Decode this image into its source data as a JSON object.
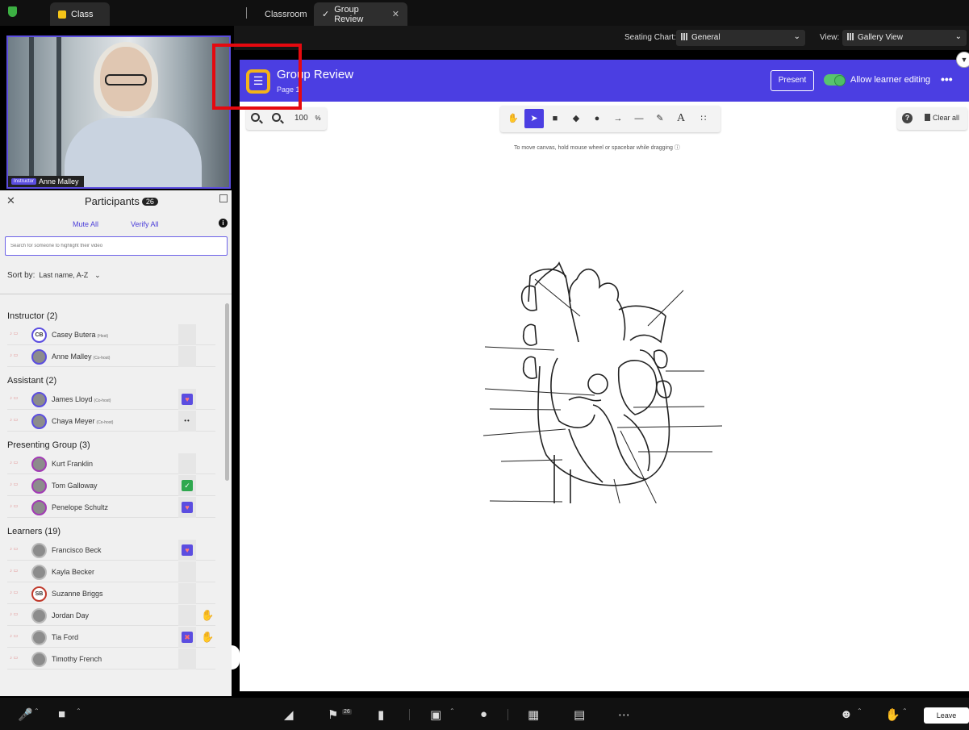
{
  "tabs": {
    "class": "Class",
    "classroom": "Classroom",
    "group_review": "Group Review"
  },
  "seating": {
    "chart_label": "Seating Chart:",
    "chart_value": "General",
    "view_label": "View:",
    "view_value": "Gallery View"
  },
  "video": {
    "role": "Instructor",
    "name": "Anne Malley"
  },
  "participants": {
    "title": "Participants",
    "count": "26",
    "mute_all": "Mute All",
    "verify_all": "Verify All",
    "search_placeholder": "Search for someone to highlight their video",
    "sort_label": "Sort by:",
    "sort_value": "Last name, A-Z",
    "groups": [
      {
        "label": "Instructor (2)",
        "members": [
          {
            "name": "Casey Butera",
            "tag": "(Host)",
            "initials": "CB",
            "status": ""
          },
          {
            "name": "Anne Malley",
            "tag": "(Co-host)",
            "initials": "",
            "status": ""
          }
        ]
      },
      {
        "label": "Assistant (2)",
        "members": [
          {
            "name": "James Lloyd",
            "tag": "(Co-host)",
            "initials": "",
            "status": "heart"
          },
          {
            "name": "Chaya Meyer",
            "tag": "(Co-host)",
            "initials": "",
            "status": "dots"
          }
        ]
      },
      {
        "label": "Presenting Group  (3)",
        "members": [
          {
            "name": "Kurt Franklin",
            "tag": "",
            "initials": "",
            "status": ""
          },
          {
            "name": "Tom Galloway",
            "tag": "",
            "initials": "",
            "status": "check"
          },
          {
            "name": "Penelope Schultz",
            "tag": "",
            "initials": "",
            "status": "heart"
          }
        ]
      },
      {
        "label": "Learners  (19)",
        "members": [
          {
            "name": "Francisco Beck",
            "tag": "",
            "initials": "",
            "status": "heart"
          },
          {
            "name": "Kayla Becker",
            "tag": "",
            "initials": "",
            "status": ""
          },
          {
            "name": "Suzanne Briggs",
            "tag": "",
            "initials": "SB",
            "status": ""
          },
          {
            "name": "Jordan Day",
            "tag": "",
            "initials": "",
            "status": "hand"
          },
          {
            "name": "Tia Ford",
            "tag": "",
            "initials": "",
            "status": "x-hand"
          },
          {
            "name": "Timothy French",
            "tag": "",
            "initials": "",
            "status": ""
          }
        ]
      }
    ]
  },
  "board": {
    "title": "Group Review",
    "subtitle": "Page 1",
    "present": "Present",
    "allow_editing": "Allow learner editing",
    "zoom": "100",
    "zoom_unit": "%",
    "clear_all": "Clear all",
    "hint": "To move canvas, hold mouse wheel or spacebar while dragging"
  },
  "bottom": {
    "participants_count": "26",
    "leave": "Leave"
  },
  "colors": {
    "accent": "#4b3ee2",
    "highlight": "#e5090f",
    "menu_ring": "#f3b31a"
  }
}
